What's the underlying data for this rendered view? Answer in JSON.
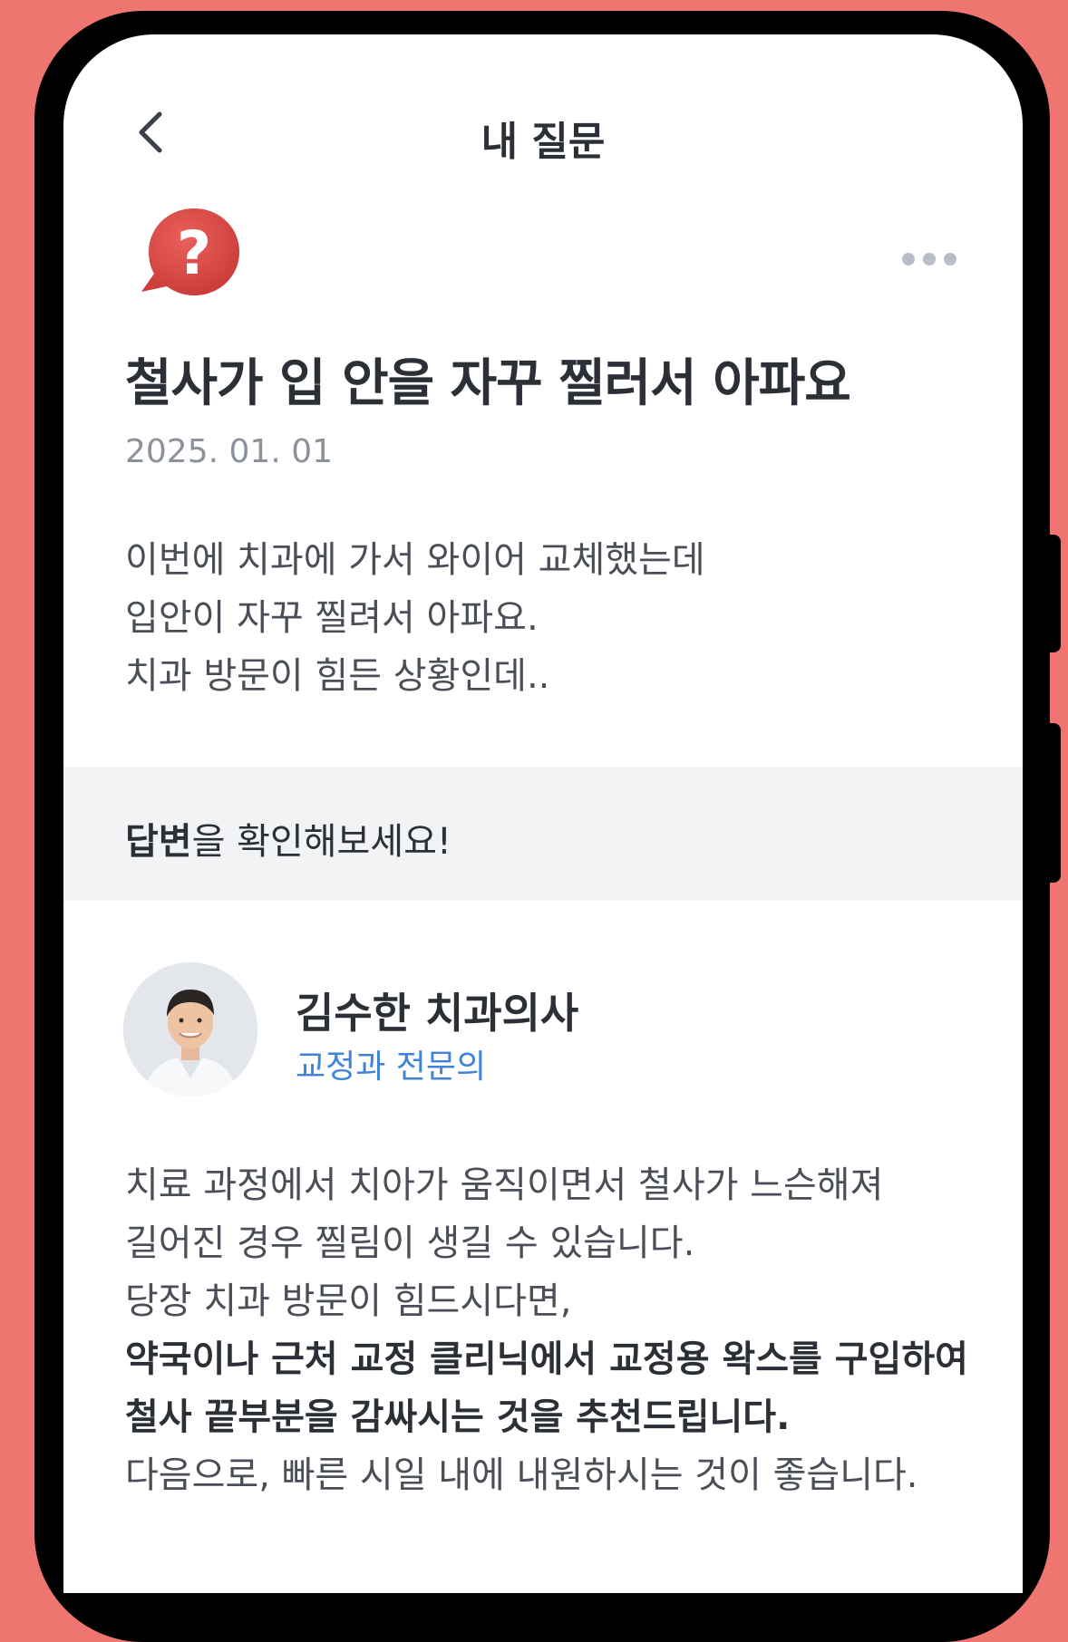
{
  "header": {
    "title": "내 질문",
    "back_icon": "chevron-left-icon"
  },
  "question": {
    "icon": "question-bubble-icon",
    "more_icon": "more-horizontal-icon",
    "title": "철사가 입 안을 자꾸 찔러서 아파요",
    "date": "2025. 01. 01",
    "body": "이번에 치과에 가서 와이어 교체했는데\n입안이 자꾸 찔려서 아파요.\n치과 방문이 힘든 상황인데.."
  },
  "answer_banner": {
    "bold_text": "답변",
    "text": "을 확인해보세요!"
  },
  "doctor": {
    "name": "김수한 치과의사",
    "specialty": "교정과 전문의"
  },
  "answer": {
    "line1": "치료 과정에서 치아가 움직이면서 철사가 느슨해져",
    "line2": "길어진 경우 찔림이 생길 수 있습니다.",
    "line3": "당장 치과 방문이 힘드시다면,",
    "bold": "약국이나 근처 교정 클리닉에서 교정용 왁스를 구입하여 철사 끝부분을 감싸시는 것을 추천드립니다.",
    "line_last": "다음으로, 빠른 시일 내에 내원하시는 것이 좋습니다."
  },
  "colors": {
    "background": "#ef7571",
    "accent_blue": "#3f84d6",
    "question_icon_red": "#dc4a47"
  }
}
